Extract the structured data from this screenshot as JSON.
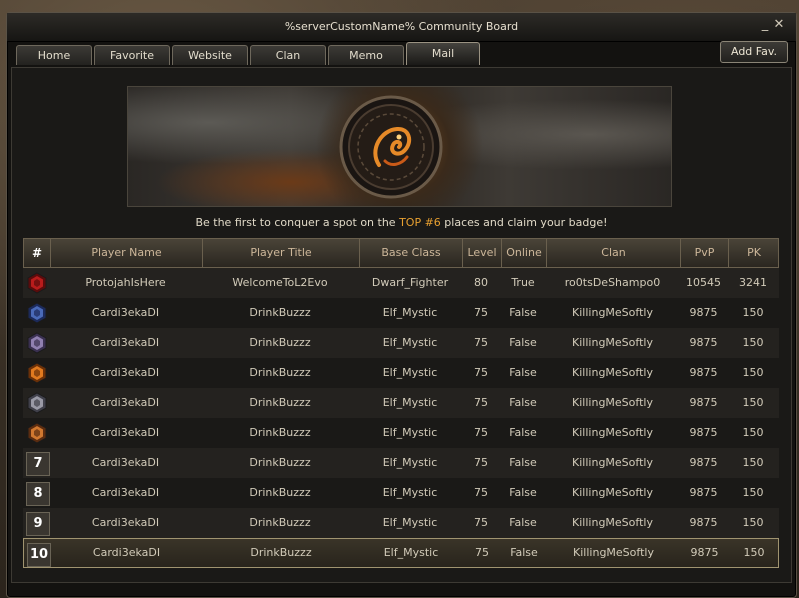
{
  "window": {
    "title": "%serverCustomName% Community Board"
  },
  "tabs": [
    {
      "label": "Home"
    },
    {
      "label": "Favorite"
    },
    {
      "label": "Website"
    },
    {
      "label": "Clan"
    },
    {
      "label": "Memo"
    },
    {
      "label": "Mail"
    }
  ],
  "add_fav_label": "Add Fav.",
  "promo": {
    "before": "Be the first to conquer a spot on the ",
    "highlight": "TOP #6",
    "after": " places and claim your badge!"
  },
  "colors": {
    "highlight": "#e8a030"
  },
  "table": {
    "headers": [
      "#",
      "Player Name",
      "Player Title",
      "Base Class",
      "Level",
      "Online",
      "Clan",
      "PvP",
      "PK"
    ],
    "rows": [
      {
        "rank": "1",
        "badge": "red",
        "name": "ProtojahIsHere",
        "title": "WelcomeToL2Evo",
        "class": "Dwarf_Fighter",
        "level": "80",
        "online": "True",
        "clan": "ro0tsDeShampo0",
        "pvp": "10545",
        "pk": "3241"
      },
      {
        "rank": "2",
        "badge": "blue",
        "name": "Cardi3ekaDI",
        "title": "DrinkBuzzz",
        "class": "Elf_Mystic",
        "level": "75",
        "online": "False",
        "clan": "KillingMeSoftly",
        "pvp": "9875",
        "pk": "150"
      },
      {
        "rank": "3",
        "badge": "violet",
        "name": "Cardi3ekaDI",
        "title": "DrinkBuzzz",
        "class": "Elf_Mystic",
        "level": "75",
        "online": "False",
        "clan": "KillingMeSoftly",
        "pvp": "9875",
        "pk": "150"
      },
      {
        "rank": "4",
        "badge": "orange",
        "name": "Cardi3ekaDI",
        "title": "DrinkBuzzz",
        "class": "Elf_Mystic",
        "level": "75",
        "online": "False",
        "clan": "KillingMeSoftly",
        "pvp": "9875",
        "pk": "150"
      },
      {
        "rank": "5",
        "badge": "grey",
        "name": "Cardi3ekaDI",
        "title": "DrinkBuzzz",
        "class": "Elf_Mystic",
        "level": "75",
        "online": "False",
        "clan": "KillingMeSoftly",
        "pvp": "9875",
        "pk": "150"
      },
      {
        "rank": "6",
        "badge": "bronze",
        "name": "Cardi3ekaDI",
        "title": "DrinkBuzzz",
        "class": "Elf_Mystic",
        "level": "75",
        "online": "False",
        "clan": "KillingMeSoftly",
        "pvp": "9875",
        "pk": "150"
      },
      {
        "rank": "7",
        "badge": "",
        "name": "Cardi3ekaDI",
        "title": "DrinkBuzzz",
        "class": "Elf_Mystic",
        "level": "75",
        "online": "False",
        "clan": "KillingMeSoftly",
        "pvp": "9875",
        "pk": "150"
      },
      {
        "rank": "8",
        "badge": "",
        "name": "Cardi3ekaDI",
        "title": "DrinkBuzzz",
        "class": "Elf_Mystic",
        "level": "75",
        "online": "False",
        "clan": "KillingMeSoftly",
        "pvp": "9875",
        "pk": "150"
      },
      {
        "rank": "9",
        "badge": "",
        "name": "Cardi3ekaDI",
        "title": "DrinkBuzzz",
        "class": "Elf_Mystic",
        "level": "75",
        "online": "False",
        "clan": "KillingMeSoftly",
        "pvp": "9875",
        "pk": "150"
      },
      {
        "rank": "10",
        "badge": "",
        "name": "Cardi3ekaDI",
        "title": "DrinkBuzzz",
        "class": "Elf_Mystic",
        "level": "75",
        "online": "False",
        "clan": "KillingMeSoftly",
        "pvp": "9875",
        "pk": "150"
      }
    ]
  }
}
